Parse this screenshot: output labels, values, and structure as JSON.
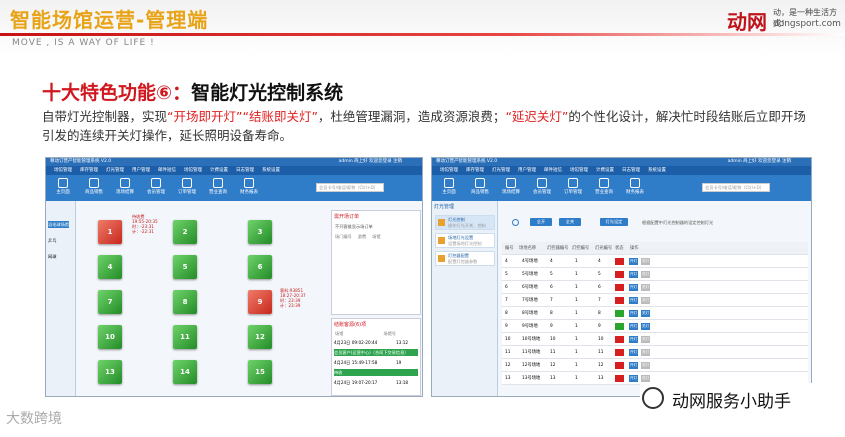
{
  "header": {
    "title": "智能场馆运营-管理端",
    "subtitle": "MOVE , IS A WAY OF LIFE !"
  },
  "logo": {
    "mark": "动网",
    "slogan": "动，是一种生活方式！",
    "url": "dongsport.com"
  },
  "heading": {
    "prefix": "十大特色功能⑥：",
    "main": "智能灯光控制系统"
  },
  "description": {
    "p1": "自带灯光控制器，实现",
    "h1": "“开场即开灯”",
    "h2": "“结账即关灯”",
    "p2": "，杜绝管理漏洞，造成资源浪费；",
    "h3": "“延迟关灯”",
    "p3": "的个性化设计，解决忙时段结账后立即开场引发的连续开关灯操作，延长照明设备寿命。"
  },
  "screens": {
    "window_title": "尊动订营产智能管理系统 V2.0",
    "user": "admin 商上好 欢迎您登录 注销",
    "menu": [
      "场馆管理",
      "库存管理",
      "灯光管理",
      "用户管理",
      "邮件短信",
      "场馆管理",
      "计费设置",
      "日志管理",
      "系统设置"
    ],
    "toolbar": [
      "主页面",
      "商品销售",
      "现场结算",
      "会员管理",
      "订单管理",
      "营业查询",
      "财务报表"
    ],
    "search_placeholder": "会员卡号/电话/昵称（Ctrl+D）",
    "left": {
      "nav": [
        "羽毛球场馆",
        "乒乓",
        "网球"
      ],
      "tiles": [
        "1",
        "2",
        "3",
        "4",
        "5",
        "6",
        "7",
        "8",
        "9",
        "10",
        "11",
        "12",
        "13",
        "14",
        "15"
      ],
      "tile1_info": [
        "待收费",
        "19:55-20:35",
        "时：-23:31",
        "计：-22:31"
      ],
      "tile9_info": [
        "客料:93851",
        "18:27-20:37",
        "时：23:39",
        "计：23:39"
      ],
      "right_title": "需开场订单",
      "right_sub": "不开客维显示场订单",
      "right_cols": [
        "场门编号",
        "游费",
        "场馆"
      ],
      "pending_title": "结账客源(6)项",
      "pending_cols": [
        "场馆",
        "场馆号"
      ],
      "pending": [
        [
          "4月23日 09:02-20:44",
          "13:12"
        ],
        [
          "会员客户(运营中心)（合同下交易信息）",
          ""
        ],
        [
          "4月24日 15:49-17:58",
          "19"
        ],
        [
          "待收",
          ""
        ],
        [
          "4月24日 19:07-20:17",
          "13:18"
        ]
      ]
    },
    "right": {
      "side_title": "灯光管理",
      "side_items": [
        {
          "t": "灯光控制",
          "d": "操作灯光开关、控制"
        },
        {
          "t": "场地灯光设置",
          "d": "设置场地灯光控制"
        },
        {
          "t": "灯控器配置",
          "d": "配置灯控器参数"
        }
      ],
      "buttons": [
        "全开",
        "全关",
        "灯光设定"
      ],
      "note": "根据配置中灯光控制器的设定控制灯光",
      "cols": [
        "编号",
        "场地名称",
        "灯控器编号",
        "灯控编号",
        "灯光编号",
        "状态",
        "操作"
      ],
      "rows": [
        [
          "4",
          "4号场地",
          "4",
          "1",
          "4"
        ],
        [
          "5",
          "5号场地",
          "5",
          "1",
          "5"
        ],
        [
          "6",
          "6号场地",
          "6",
          "1",
          "6"
        ],
        [
          "7",
          "7号场地",
          "7",
          "1",
          "7"
        ],
        [
          "8",
          "8号场地",
          "8",
          "1",
          "8"
        ],
        [
          "9",
          "9号场地",
          "9",
          "1",
          "9"
        ],
        [
          "10",
          "10号场地",
          "10",
          "1",
          "10"
        ],
        [
          "11",
          "11号场地",
          "11",
          "1",
          "11"
        ],
        [
          "12",
          "12号场地",
          "12",
          "1",
          "12"
        ],
        [
          "13",
          "13号场地",
          "13",
          "1",
          "13"
        ]
      ],
      "on_label": "开灯",
      "off_label": "关灯"
    }
  },
  "watermark": "大数跨境",
  "brand": "动网服务小助手",
  "colors": {
    "accent": "#d0171e",
    "ui_blue": "#2f7cc9",
    "tile_green": "#2f9a33",
    "tile_red": "#d0301e"
  }
}
